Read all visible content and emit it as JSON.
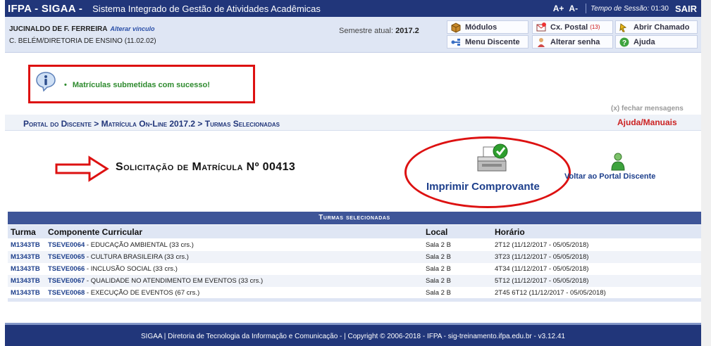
{
  "topbar": {
    "system_title": "IFPA - SIGAA -",
    "system_name": "Sistema Integrado de Gestão de Atividades Acadêmicas",
    "font_increase": "A+",
    "font_decrease": "A-",
    "session_label": "Tempo de Sessão:",
    "session_time": "01:30",
    "logout": "SAIR"
  },
  "user": {
    "name": "JUCINALDO DE F. FERREIRA",
    "change_link": "Alterar vínculo",
    "unit": "C. BELÉM/DIRETORIA DE ENSINO (11.02.02)",
    "semester_label": "Semestre atual:",
    "semester_value": "2017.2"
  },
  "menu": {
    "modulos": "Módulos",
    "cx_postal": "Cx. Postal",
    "cx_postal_count": "(13)",
    "abrir_chamado": "Abrir Chamado",
    "menu_discente": "Menu Discente",
    "alterar_senha": "Alterar senha",
    "ajuda": "Ajuda"
  },
  "message": {
    "text": "Matrículas submetidas com sucesso!",
    "close": "(x) fechar mensagens"
  },
  "breadcrumb": {
    "path": "Portal do Discente > Matrícula On-Line 2017.2 > Turmas Selecionadas",
    "help": "Ajuda/Manuais"
  },
  "request": {
    "title": "Solicitação de Matrícula Nº 00413",
    "print_label": "Imprimir Comprovante",
    "back_label": "Voltar ao Portal Discente"
  },
  "table": {
    "title": "Turmas selecionadas",
    "columns": [
      "Turma",
      "Componente Curricular",
      "Local",
      "Horário"
    ],
    "rows": [
      {
        "turma": "M1343TB",
        "code": "TSEVE0064",
        "name": " - EDUCAÇÃO AMBIENTAL (33 crs.)",
        "local": "Sala 2 B",
        "horario": "2T12 (11/12/2017 - 05/05/2018)"
      },
      {
        "turma": "M1343TB",
        "code": "TSEVE0065",
        "name": " - CULTURA BRASILEIRA (33 crs.)",
        "local": "Sala 2 B",
        "horario": "3T23 (11/12/2017 - 05/05/2018)"
      },
      {
        "turma": "M1343TB",
        "code": "TSEVE0066",
        "name": " - INCLUSÃO SOCIAL (33 crs.)",
        "local": "Sala 2 B",
        "horario": "4T34 (11/12/2017 - 05/05/2018)"
      },
      {
        "turma": "M1343TB",
        "code": "TSEVE0067",
        "name": " - QUALIDADE NO ATENDIMENTO EM EVENTOS (33 crs.)",
        "local": "Sala 2 B",
        "horario": "5T12 (11/12/2017 - 05/05/2018)"
      },
      {
        "turma": "M1343TB",
        "code": "TSEVE0068",
        "name": " - EXECUÇÃO DE EVENTOS (67 crs.)",
        "local": "Sala 2 B",
        "horario": "2T45 6T12 (11/12/2017 - 05/05/2018)"
      }
    ]
  },
  "footer": {
    "text": "SIGAA | Diretoria de Tecnologia da Informação e Comunicação - | Copyright © 2006-2018 - IFPA - sig-treinamento.ifpa.edu.br - v3.12.41"
  },
  "colors": {
    "brand_blue": "#21367a",
    "highlight_red": "#dd1111",
    "success_green": "#2d8a2d"
  },
  "icons": [
    "info-icon",
    "modulos-icon",
    "mail-icon",
    "chamado-icon",
    "menu-discente-icon",
    "key-user-icon",
    "help-icon",
    "arrow-icon",
    "printer-icon",
    "check-icon",
    "user-icon"
  ]
}
